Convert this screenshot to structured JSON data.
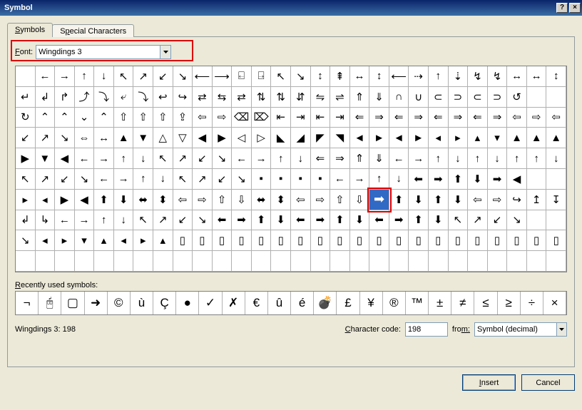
{
  "window": {
    "title": "Symbol",
    "help_glyph": "?",
    "close_glyph": "×"
  },
  "tabs": {
    "active": "Symbols",
    "inactive": "Special Characters"
  },
  "font": {
    "label_pre": "F",
    "label_post": "ont:",
    "value": "Wingdings 3"
  },
  "grid": {
    "cols": 28,
    "rows": 10,
    "selected_index": 186,
    "cells": [
      "",
      "←",
      "→",
      "↑",
      "↓",
      "↖",
      "↗",
      "↙",
      "↘",
      "⟵",
      "⟶",
      "⍇",
      "⍈",
      "↖",
      "↘",
      "↕",
      "⇞",
      "↔",
      "↕",
      "⟵",
      "⇢",
      "↑",
      "⇣",
      "↯",
      "↯",
      "↔",
      "↔",
      "↕",
      "↵",
      "↲",
      "↱",
      "⤴",
      "⤵",
      "⤶",
      "⤵",
      "↩",
      "↪",
      "⇄",
      "⇆",
      "⇄",
      "⇅",
      "⇅",
      "⇵",
      "⇋",
      "⇌",
      "⇑",
      "⇓",
      "∩",
      "∪",
      "⊂",
      "⊃",
      "⊂",
      "⊃",
      "↺",
      "",
      "",
      "↻",
      "⌃",
      "⌃",
      "⌄",
      "⌃",
      "⇧",
      "⇧",
      "⇧",
      "⇪",
      "⇦",
      "⇨",
      "⌫",
      "⌦",
      "⇤",
      "⇥",
      "⇤",
      "⇥",
      "⇐",
      "⇒",
      "⇐",
      "⇒",
      "⇐",
      "⇒",
      "⇐",
      "⇒",
      "⇦",
      "⇨",
      "⇦",
      "↙",
      "↗",
      "↘",
      "⇔",
      "↔",
      "▲",
      "▼",
      "△",
      "▽",
      "◀",
      "▶",
      "◁",
      "▷",
      "◣",
      "◢",
      "◤",
      "◥",
      "◄",
      "►",
      "◄",
      "►",
      "◂",
      "▸",
      "▴",
      "▾",
      "▲",
      "▲",
      "▲",
      "▶",
      "▼",
      "◀",
      "←",
      "→",
      "↑",
      "↓",
      "↖",
      "↗",
      "↙",
      "↘",
      "←",
      "→",
      "↑",
      "↓",
      "⇐",
      "⇒",
      "⇑",
      "⇓",
      "←",
      "→",
      "↑",
      "↓",
      "↑",
      "↓",
      "↑",
      "↑",
      "↓",
      "↖",
      "↗",
      "↙",
      "↘",
      "←",
      "→",
      "↑",
      "↓",
      "↖",
      "↗",
      "↙",
      "↘",
      "▪",
      "▪",
      "▪",
      "▪",
      "←",
      "→",
      "↑",
      "↓",
      "⬅",
      "➡",
      "⬆",
      "⬇",
      "➡",
      "◀",
      "",
      "",
      "▸",
      "◂",
      "▶",
      "◀",
      "⬆",
      "⬇",
      "⬌",
      "⬍",
      "⇦",
      "⇨",
      "⇧",
      "⇩",
      "⬌",
      "⬍",
      "⇦",
      "⇨",
      "⇧",
      "⇩",
      "➡",
      "⬆",
      "⬇",
      "⬆",
      "⬇",
      "⇦",
      "⇨",
      "↪",
      "↥",
      "↧",
      "↲",
      "↳",
      "←",
      "→",
      "↑",
      "↓",
      "↖",
      "↗",
      "↙",
      "↘",
      "⬅",
      "➡",
      "⬆",
      "⬇",
      "⬅",
      "➡",
      "⬆",
      "⬇",
      "⬅",
      "➡",
      "⬆",
      "⬇",
      "↖",
      "↗",
      "↙",
      "↘",
      "",
      "",
      "↘",
      "◂",
      "▸",
      "▾",
      "▴",
      "◂",
      "▸",
      "▴",
      "▯",
      "▯",
      "▯",
      "▯",
      "▯",
      "▯",
      "▯",
      "▯",
      "▯",
      "▯",
      "▯",
      "▯",
      "▯",
      "▯",
      "▯",
      "▯",
      "▯",
      "▯",
      "▯",
      "▯",
      "",
      "",
      "",
      "",
      "",
      "",
      "",
      "",
      "",
      "",
      "",
      "",
      "",
      "",
      "",
      "",
      "",
      "",
      "",
      "",
      "",
      "",
      "",
      "",
      "",
      "",
      "",
      ""
    ]
  },
  "recent": {
    "label_pre": "R",
    "label_post": "ecently used symbols:",
    "cells": [
      "¬",
      "🖰",
      "▢",
      "➜",
      "©",
      "ù",
      "Ç",
      "●",
      "✓",
      "✗",
      "€",
      "û",
      "é",
      "💣",
      "£",
      "¥",
      "®",
      "™",
      "±",
      "≠",
      "≤",
      "≥",
      "÷",
      "×"
    ]
  },
  "status": {
    "text": "Wingdings 3: 198",
    "charcode_label_pre": "C",
    "charcode_label_post": "haracter code:",
    "charcode_value": "198",
    "from_label_pre": "fro",
    "from_label_post": "m:",
    "from_value": "Symbol (decimal)"
  },
  "buttons": {
    "insert": "Insert",
    "cancel": "Cancel"
  }
}
